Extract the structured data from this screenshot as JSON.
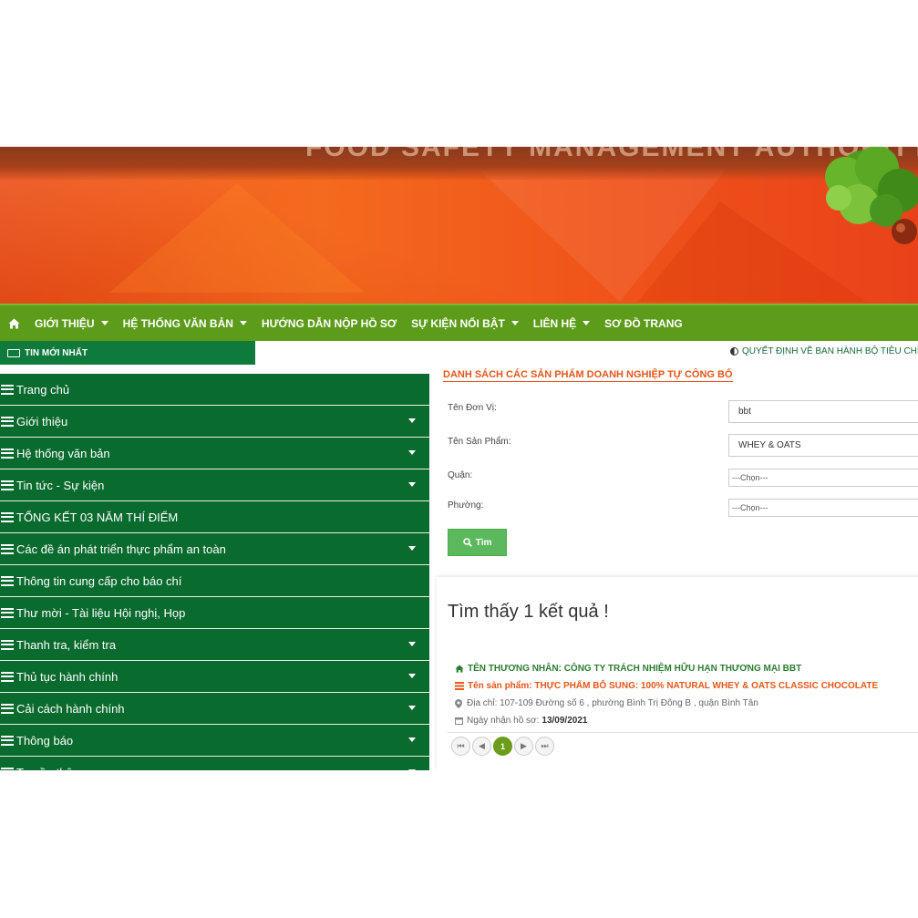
{
  "banner": {
    "title": "FOOD SAFETY MANAGEMENT AUTHORITY OF HCM CITY"
  },
  "nav": {
    "home_icon": "home-icon",
    "items": [
      {
        "label": "GIỚI THIỆU",
        "dropdown": true
      },
      {
        "label": "HỆ THỐNG VĂN BẢN",
        "dropdown": true
      },
      {
        "label": "HƯỚNG DẪN NỘP HỒ SƠ",
        "dropdown": false
      },
      {
        "label": "SỰ KIỆN NỔI BẬT",
        "dropdown": true
      },
      {
        "label": "LIÊN HỆ",
        "dropdown": true
      },
      {
        "label": "SƠ ĐỒ TRANG",
        "dropdown": false
      }
    ]
  },
  "news": {
    "label": "TIN MỚI NHẤT",
    "ticker": "QUYẾT ĐỊNH VỀ BAN HÀNH BỘ TIÊU CHÍ Đ"
  },
  "sidebar": {
    "items": [
      {
        "label": "Trang chủ",
        "dropdown": false
      },
      {
        "label": "Giới thiệu",
        "dropdown": true
      },
      {
        "label": "Hệ thống văn bản",
        "dropdown": true
      },
      {
        "label": "Tin tức - Sự kiện",
        "dropdown": true
      },
      {
        "label": "TỔNG KẾT 03 NĂM THÍ ĐIỂM",
        "dropdown": false
      },
      {
        "label": "Các đề án phát triển thực phẩm an toàn",
        "dropdown": true
      },
      {
        "label": "Thông tin cung cấp cho báo chí",
        "dropdown": false
      },
      {
        "label": "Thư mời - Tài liệu Hội nghị, Họp",
        "dropdown": false
      },
      {
        "label": "Thanh tra, kiểm tra",
        "dropdown": true
      },
      {
        "label": "Thủ tục hành chính",
        "dropdown": true
      },
      {
        "label": "Cải cách hành chính",
        "dropdown": true
      },
      {
        "label": "Thông báo",
        "dropdown": true
      },
      {
        "label": "Truyền thông",
        "dropdown": true
      }
    ]
  },
  "form": {
    "title": "DANH SÁCH CÁC SẢN PHẨM DOANH NGHIỆP TỰ CÔNG BỐ",
    "unit_label": "Tên Đơn Vị:",
    "unit_value": "bbt",
    "product_label": "Tên Sản Phẩm:",
    "product_value": "WHEY & OATS",
    "district_label": "Quận:",
    "district_value": "---Chọn---",
    "ward_label": "Phường:",
    "ward_value": "---Chọn---",
    "search_label": "Tìm"
  },
  "results": {
    "found_text": "Tìm thấy 1 kết quả !",
    "trader": "TÊN THƯƠNG NHÂN: CÔNG TY TRÁCH NHIỆM HỮU HẠN THƯƠNG MẠI BBT",
    "product": "Tên sản phẩm: THỰC PHẨM BỔ SUNG: 100% NATURAL WHEY & OATS CLASSIC CHOCOLATE",
    "address": "Địa chỉ: 107-109 Đường số 6 , phường Bình Trị Đông B , quận Bình Tân",
    "date_label": "Ngày nhận hồ sơ:",
    "date_value": "13/09/2021"
  },
  "pager": {
    "first": "⏮",
    "prev": "◀",
    "current": "1",
    "next": "▶",
    "last": "⏭"
  },
  "colors": {
    "nav_green": "#5d9c1a",
    "sidebar_green": "#0a6b2f",
    "accent_orange": "#e8561a",
    "button_green": "#5cb85c"
  }
}
